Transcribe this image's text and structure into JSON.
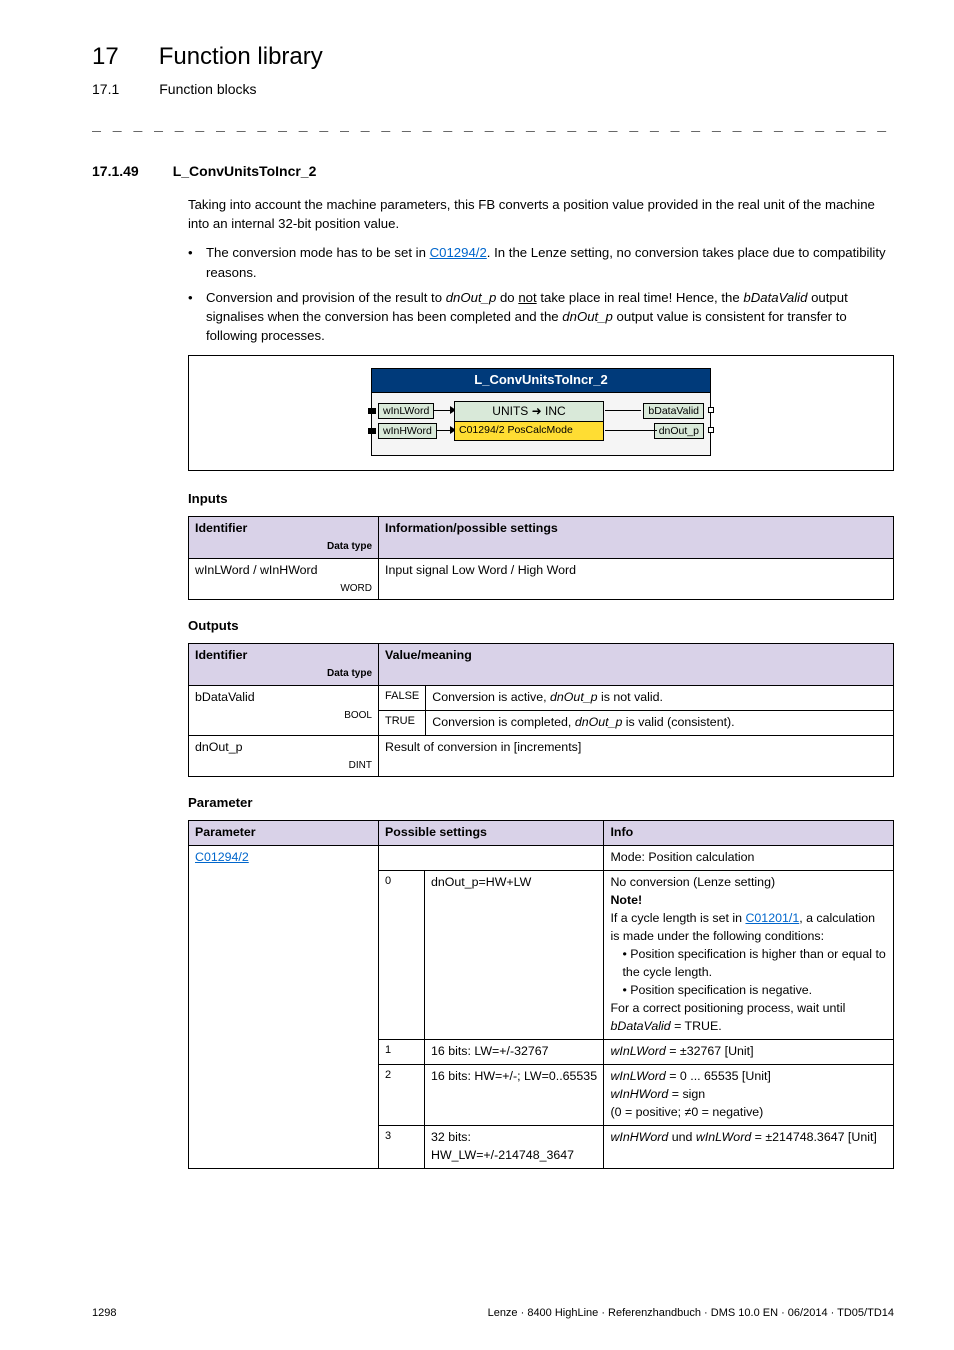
{
  "chapter": {
    "num": "17",
    "title": "Function library"
  },
  "subchapter": {
    "num": "17.1",
    "title": "Function blocks"
  },
  "dashline": "_ _ _ _ _ _ _ _ _ _ _ _ _ _ _ _ _ _ _ _ _ _ _ _ _ _ _ _ _ _ _ _ _ _ _ _ _ _ _ _ _ _ _ _ _ _ _ _ _ _ _ _ _ _ _ _ _ _ _ _ _ _ _ _",
  "section": {
    "num": "17.1.49",
    "title": "L_ConvUnitsToIncr_2"
  },
  "intro": "Taking into account the machine parameters, this FB converts a position value provided in the real unit of the machine into an internal 32-bit position value.",
  "bullets": [
    {
      "pre": "The conversion mode has to be set in ",
      "link": "C01294/2",
      "post": ". In the Lenze setting, no conversion takes place due to compatibility reasons."
    },
    {
      "full_a": "Conversion and provision of the result to ",
      "it1": "dnOut_p",
      "mid1": " do ",
      "under": "not",
      "mid2": " take place in real time! Hence, the ",
      "it2": "bDataValid",
      "mid3": " output signalises when the conversion has been completed and the ",
      "it3": "dnOut_p",
      "post": " output value is consistent for transfer to following processes."
    }
  ],
  "diagram": {
    "title": "L_ConvUnitsToIncr_2",
    "inL1": "wInLWord",
    "inL2": "wInHWord",
    "outR1": "bDataValid",
    "outR2": "dnOut_p",
    "innerTop": "UNITS ➜ INC",
    "innerBotCode": "C01294/2",
    "innerBotLabel": " PosCalcMode"
  },
  "inputs": {
    "head": "Inputs",
    "th1": "Identifier",
    "th1sub": "Data type",
    "th2": "Information/possible settings",
    "r1c1": "wInLWord / wInHWord",
    "r1c1dt": "WORD",
    "r1c2": "Input signal Low Word / High Word"
  },
  "outputs": {
    "head": "Outputs",
    "th1": "Identifier",
    "th1sub": "Data type",
    "th2": "Value/meaning",
    "r1c1": "bDataValid",
    "r1c1dt": "BOOL",
    "r1v1": "FALSE",
    "r1d1a": "Conversion is active, ",
    "r1d1it": "dnOut_p",
    "r1d1b": " is not valid.",
    "r1v2": "TRUE",
    "r1d2a": "Conversion is completed, ",
    "r1d2it": "dnOut_p",
    "r1d2b": " is valid (consistent).",
    "r2c1": "dnOut_p",
    "r2c1dt": "DINT",
    "r2c2": "Result of conversion in [increments]"
  },
  "params": {
    "head": "Parameter",
    "th1": "Parameter",
    "th2": "Possible settings",
    "th3": "Info",
    "pcode": "C01294/2",
    "r0info": "Mode: Position calculation",
    "r1num": "0",
    "r1set": "dnOut_p=HW+LW",
    "r1info_l1": "No conversion (Lenze setting)",
    "r1info_note": "Note!",
    "r1info_l2a": "If a cycle length is set in ",
    "r1info_link": "C01201/1",
    "r1info_l2b": ", a calculation is made under the following conditions:",
    "r1info_b1": "Position specification is higher than or equal to the cycle length.",
    "r1info_b2": "Position specification is negative.",
    "r1info_l3a": "For a correct positioning process, wait until ",
    "r1info_l3it": "bDataValid",
    "r1info_l3b": " = TRUE.",
    "r2num": "1",
    "r2set": "16 bits: LW=+/-32767",
    "r2info_it": "wInLWord",
    "r2info": " = ±32767 [Unit]",
    "r3num": "2",
    "r3set": "16 bits: HW=+/-; LW=0..65535",
    "r3info_it1": "wInLWord",
    "r3info_a": " = 0 ... 65535 [Unit]",
    "r3info_it2": "wInHWord",
    "r3info_b": " = sign",
    "r3info_c": "(0 = positive; ≠0 = negative)",
    "r4num": "3",
    "r4set": "32 bits: HW_LW=+/-214748_3647",
    "r4info_it1": "wInHWord",
    "r4info_mid": " und ",
    "r4info_it2": "wInLWord",
    "r4info_a": " = ±214748.3647 [Unit]"
  },
  "footer": {
    "page": "1298",
    "meta": "Lenze · 8400 HighLine · Referenzhandbuch · DMS 10.0 EN · 06/2014 · TD05/TD14"
  }
}
